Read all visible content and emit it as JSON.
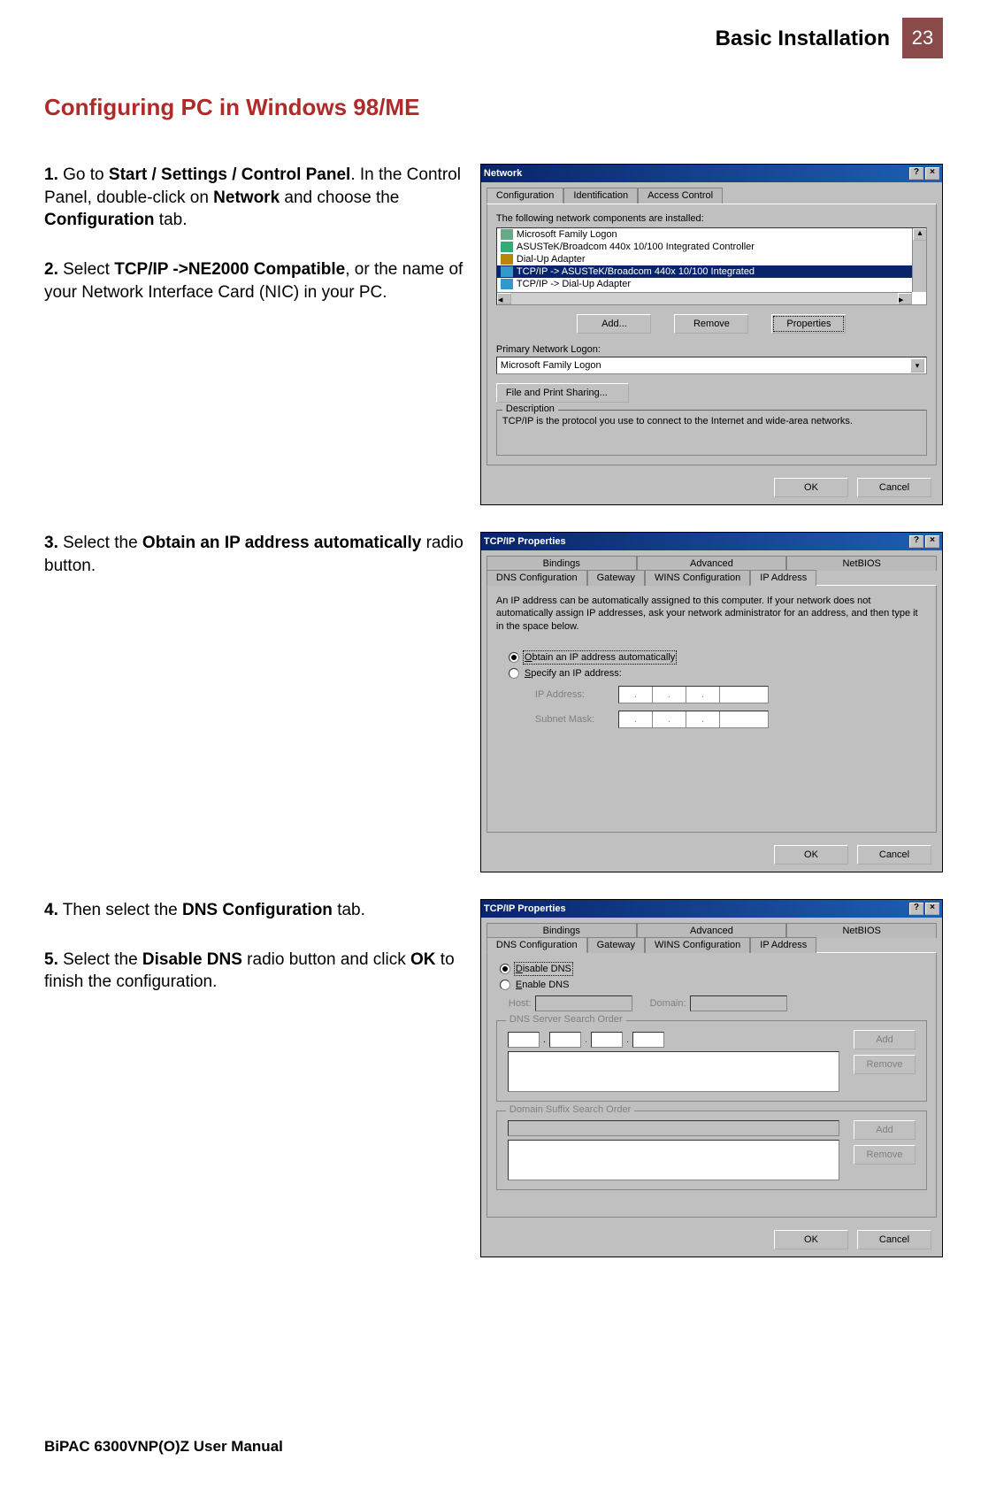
{
  "header": {
    "title": "Basic Installation",
    "page_number": "23"
  },
  "section_title": "Configuring PC in Windows 98/ME",
  "steps": {
    "s1a": "1.",
    "s1b": " Go to ",
    "s1c": "Start / Settings / Control Panel",
    "s1d": ". In the Control Panel, double-click on ",
    "s1e": "Network",
    "s1f": " and choose the ",
    "s1g": "Configuration",
    "s1h": " tab.",
    "s2a": "2.",
    "s2b": " Select ",
    "s2c": "TCP/IP ->NE2000 Compatible",
    "s2d": ", or the name of your Network Interface Card (NIC) in your PC.",
    "s3a": "3.",
    "s3b": " Select the ",
    "s3c": "Obtain an IP address automatically",
    "s3d": " radio button.",
    "s4a": "4.",
    "s4b": " Then select the ",
    "s4c": "DNS Configuration",
    "s4d": " tab.",
    "s5a": "5.",
    "s5b": " Select the ",
    "s5c": "Disable DNS",
    "s5d": " radio button and click ",
    "s5e": "OK",
    "s5f": " to finish the configuration."
  },
  "network_dialog": {
    "title": "Network",
    "tabs": [
      "Configuration",
      "Identification",
      "Access Control"
    ],
    "intro_label": "The following network components are installed:",
    "components": [
      "Microsoft Family Logon",
      "ASUSTeK/Broadcom 440x 10/100 Integrated Controller",
      "Dial-Up Adapter",
      "TCP/IP -> ASUSTeK/Broadcom 440x 10/100 Integrated",
      "TCP/IP -> Dial-Up Adapter"
    ],
    "btn_add": "Add...",
    "btn_remove": "Remove",
    "btn_properties": "Properties",
    "primary_logon_label": "Primary Network Logon:",
    "primary_logon_value": "Microsoft Family Logon",
    "file_print": "File and Print Sharing...",
    "desc_label": "Description",
    "desc_text": "TCP/IP is the protocol you use to connect to the Internet and wide-area networks.",
    "ok": "OK",
    "cancel": "Cancel"
  },
  "tcpip_ip": {
    "title": "TCP/IP Properties",
    "tabs_top": [
      "Bindings",
      "Advanced",
      "NetBIOS"
    ],
    "tabs_bottom": [
      "DNS Configuration",
      "Gateway",
      "WINS Configuration",
      "IP Address"
    ],
    "intro": "An IP address can be automatically assigned to this computer. If your network does not automatically assign IP addresses, ask your network administrator for an address, and then type it in the space below.",
    "radio_obtain": "Obtain an IP address automatically",
    "radio_specify": "Specify an IP address:",
    "ip_label": "IP Address:",
    "subnet_label": "Subnet Mask:",
    "ok": "OK",
    "cancel": "Cancel"
  },
  "tcpip_dns": {
    "title": "TCP/IP Properties",
    "tabs_top": [
      "Bindings",
      "Advanced",
      "NetBIOS"
    ],
    "tabs_bottom": [
      "DNS Configuration",
      "Gateway",
      "WINS Configuration",
      "IP Address"
    ],
    "radio_disable": "Disable DNS",
    "radio_enable": "Enable DNS",
    "host_label": "Host:",
    "domain_label": "Domain:",
    "dns_order_label": "DNS Server Search Order",
    "suffix_order_label": "Domain Suffix Search Order",
    "btn_add": "Add",
    "btn_remove": "Remove",
    "ok": "OK",
    "cancel": "Cancel"
  },
  "footer": "BiPAC 6300VNP(O)Z User Manual"
}
